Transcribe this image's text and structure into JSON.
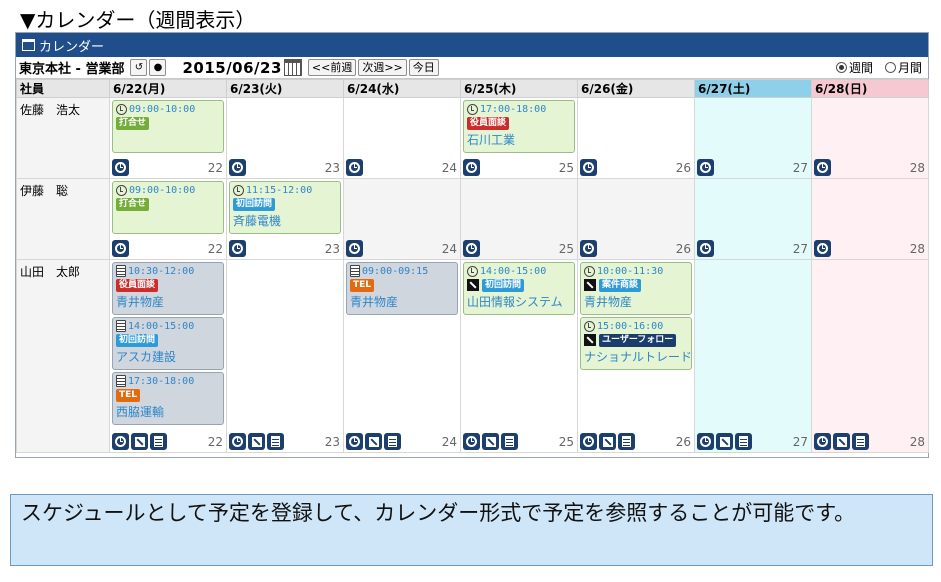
{
  "heading": "▼カレンダー（週間表示）",
  "window": {
    "title": "カレンダー"
  },
  "toolbar": {
    "dept": "東京本社 - 営業部",
    "date": "2015/06/23",
    "prev_label": "<<前週",
    "next_label": "次週>>",
    "today_label": "今日",
    "view_week": "週間",
    "view_month": "月間"
  },
  "grid": {
    "employee_header": "社員",
    "days": [
      {
        "label": "6/22(月)",
        "num": "22",
        "type": "weekday"
      },
      {
        "label": "6/23(火)",
        "num": "23",
        "type": "weekday"
      },
      {
        "label": "6/24(水)",
        "num": "24",
        "type": "weekday"
      },
      {
        "label": "6/25(木)",
        "num": "25",
        "type": "weekday"
      },
      {
        "label": "6/26(金)",
        "num": "26",
        "type": "weekday"
      },
      {
        "label": "6/27(土)",
        "num": "27",
        "type": "sat"
      },
      {
        "label": "6/28(日)",
        "num": "28",
        "type": "sun"
      }
    ],
    "employees": [
      {
        "name": "佐藤　浩太",
        "row_height": 81,
        "footer_buttons": [
          "clock"
        ],
        "events": [
          [
            {
              "time": "09:00-10:00",
              "icon": "clock",
              "label": "打合せ",
              "label_color": "green",
              "company": "",
              "bg": "green"
            }
          ],
          [],
          [],
          [
            {
              "time": "17:00-18:00",
              "icon": "clock",
              "label": "役員面談",
              "label_color": "red",
              "company": "石川工業",
              "bg": "green"
            }
          ],
          [],
          [],
          []
        ]
      },
      {
        "name": "伊藤　聡",
        "row_height": 81,
        "footer_buttons": [
          "clock"
        ],
        "events": [
          [
            {
              "time": "09:00-10:00",
              "icon": "clock",
              "label": "打合せ",
              "label_color": "green",
              "company": "",
              "bg": "green"
            }
          ],
          [
            {
              "time": "11:15-12:00",
              "icon": "clock",
              "label": "初回訪問",
              "label_color": "blue",
              "company": "斉藤電機",
              "bg": "green"
            }
          ],
          [],
          [],
          [],
          [],
          []
        ]
      },
      {
        "name": "山田　太郎",
        "row_height": 193,
        "footer_buttons": [
          "clock",
          "phone",
          "doc"
        ],
        "events": [
          [
            {
              "time": "10:30-12:00",
              "icon": "doc",
              "label": "役員面談",
              "label_color": "red",
              "company": "青井物産",
              "bg": "gray"
            },
            {
              "time": "14:00-15:00",
              "icon": "doc",
              "label": "初回訪問",
              "label_color": "blue",
              "company": "アスカ建設",
              "bg": "gray"
            },
            {
              "time": "17:30-18:00",
              "icon": "doc",
              "label": "TEL",
              "label_color": "orange",
              "company": "西脇運輸",
              "bg": "gray"
            }
          ],
          [],
          [
            {
              "time": "09:00-09:15",
              "icon": "doc",
              "label": "TEL",
              "label_color": "orange",
              "company": "青井物産",
              "bg": "gray"
            }
          ],
          [
            {
              "time": "14:00-15:00",
              "icon": "clock",
              "phone": true,
              "label": "初回訪問",
              "label_color": "blue",
              "company": "山田情報システム",
              "bg": "green"
            }
          ],
          [
            {
              "time": "10:00-11:30",
              "icon": "clock",
              "phone": true,
              "label": "案件商談",
              "label_color": "blue",
              "company": "青井物産",
              "bg": "green"
            },
            {
              "time": "15:00-16:00",
              "icon": "clock",
              "phone": true,
              "label": "ユーザーフォロー",
              "label_color": "navy",
              "company": "ナショナルトレード",
              "bg": "green"
            }
          ],
          [],
          []
        ]
      }
    ]
  },
  "note": "スケジュールとして予定を登録して、カレンダー形式で予定を参照することが可能です。",
  "colors": {
    "titlebar": "#1f4e8a",
    "saturday_header": "#8ed0ea",
    "sunday_header": "#f6c9d2",
    "event_time": "#2e86c9"
  }
}
